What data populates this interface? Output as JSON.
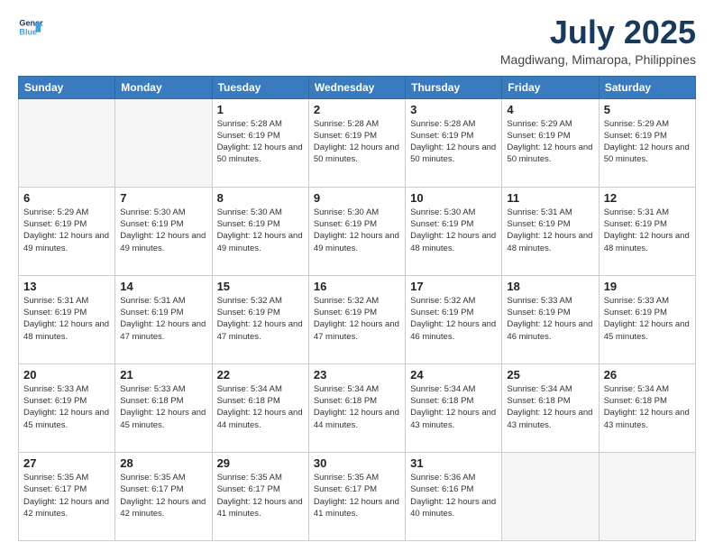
{
  "logo": {
    "line1": "General",
    "line2": "Blue"
  },
  "title": {
    "month_year": "July 2025",
    "location": "Magdiwang, Mimaropa, Philippines"
  },
  "days_of_week": [
    "Sunday",
    "Monday",
    "Tuesday",
    "Wednesday",
    "Thursday",
    "Friday",
    "Saturday"
  ],
  "weeks": [
    [
      {
        "day": "",
        "info": ""
      },
      {
        "day": "",
        "info": ""
      },
      {
        "day": "1",
        "info": "Sunrise: 5:28 AM\nSunset: 6:19 PM\nDaylight: 12 hours and 50 minutes."
      },
      {
        "day": "2",
        "info": "Sunrise: 5:28 AM\nSunset: 6:19 PM\nDaylight: 12 hours and 50 minutes."
      },
      {
        "day": "3",
        "info": "Sunrise: 5:28 AM\nSunset: 6:19 PM\nDaylight: 12 hours and 50 minutes."
      },
      {
        "day": "4",
        "info": "Sunrise: 5:29 AM\nSunset: 6:19 PM\nDaylight: 12 hours and 50 minutes."
      },
      {
        "day": "5",
        "info": "Sunrise: 5:29 AM\nSunset: 6:19 PM\nDaylight: 12 hours and 50 minutes."
      }
    ],
    [
      {
        "day": "6",
        "info": "Sunrise: 5:29 AM\nSunset: 6:19 PM\nDaylight: 12 hours and 49 minutes."
      },
      {
        "day": "7",
        "info": "Sunrise: 5:30 AM\nSunset: 6:19 PM\nDaylight: 12 hours and 49 minutes."
      },
      {
        "day": "8",
        "info": "Sunrise: 5:30 AM\nSunset: 6:19 PM\nDaylight: 12 hours and 49 minutes."
      },
      {
        "day": "9",
        "info": "Sunrise: 5:30 AM\nSunset: 6:19 PM\nDaylight: 12 hours and 49 minutes."
      },
      {
        "day": "10",
        "info": "Sunrise: 5:30 AM\nSunset: 6:19 PM\nDaylight: 12 hours and 48 minutes."
      },
      {
        "day": "11",
        "info": "Sunrise: 5:31 AM\nSunset: 6:19 PM\nDaylight: 12 hours and 48 minutes."
      },
      {
        "day": "12",
        "info": "Sunrise: 5:31 AM\nSunset: 6:19 PM\nDaylight: 12 hours and 48 minutes."
      }
    ],
    [
      {
        "day": "13",
        "info": "Sunrise: 5:31 AM\nSunset: 6:19 PM\nDaylight: 12 hours and 48 minutes."
      },
      {
        "day": "14",
        "info": "Sunrise: 5:31 AM\nSunset: 6:19 PM\nDaylight: 12 hours and 47 minutes."
      },
      {
        "day": "15",
        "info": "Sunrise: 5:32 AM\nSunset: 6:19 PM\nDaylight: 12 hours and 47 minutes."
      },
      {
        "day": "16",
        "info": "Sunrise: 5:32 AM\nSunset: 6:19 PM\nDaylight: 12 hours and 47 minutes."
      },
      {
        "day": "17",
        "info": "Sunrise: 5:32 AM\nSunset: 6:19 PM\nDaylight: 12 hours and 46 minutes."
      },
      {
        "day": "18",
        "info": "Sunrise: 5:33 AM\nSunset: 6:19 PM\nDaylight: 12 hours and 46 minutes."
      },
      {
        "day": "19",
        "info": "Sunrise: 5:33 AM\nSunset: 6:19 PM\nDaylight: 12 hours and 45 minutes."
      }
    ],
    [
      {
        "day": "20",
        "info": "Sunrise: 5:33 AM\nSunset: 6:19 PM\nDaylight: 12 hours and 45 minutes."
      },
      {
        "day": "21",
        "info": "Sunrise: 5:33 AM\nSunset: 6:18 PM\nDaylight: 12 hours and 45 minutes."
      },
      {
        "day": "22",
        "info": "Sunrise: 5:34 AM\nSunset: 6:18 PM\nDaylight: 12 hours and 44 minutes."
      },
      {
        "day": "23",
        "info": "Sunrise: 5:34 AM\nSunset: 6:18 PM\nDaylight: 12 hours and 44 minutes."
      },
      {
        "day": "24",
        "info": "Sunrise: 5:34 AM\nSunset: 6:18 PM\nDaylight: 12 hours and 43 minutes."
      },
      {
        "day": "25",
        "info": "Sunrise: 5:34 AM\nSunset: 6:18 PM\nDaylight: 12 hours and 43 minutes."
      },
      {
        "day": "26",
        "info": "Sunrise: 5:34 AM\nSunset: 6:18 PM\nDaylight: 12 hours and 43 minutes."
      }
    ],
    [
      {
        "day": "27",
        "info": "Sunrise: 5:35 AM\nSunset: 6:17 PM\nDaylight: 12 hours and 42 minutes."
      },
      {
        "day": "28",
        "info": "Sunrise: 5:35 AM\nSunset: 6:17 PM\nDaylight: 12 hours and 42 minutes."
      },
      {
        "day": "29",
        "info": "Sunrise: 5:35 AM\nSunset: 6:17 PM\nDaylight: 12 hours and 41 minutes."
      },
      {
        "day": "30",
        "info": "Sunrise: 5:35 AM\nSunset: 6:17 PM\nDaylight: 12 hours and 41 minutes."
      },
      {
        "day": "31",
        "info": "Sunrise: 5:36 AM\nSunset: 6:16 PM\nDaylight: 12 hours and 40 minutes."
      },
      {
        "day": "",
        "info": ""
      },
      {
        "day": "",
        "info": ""
      }
    ]
  ]
}
